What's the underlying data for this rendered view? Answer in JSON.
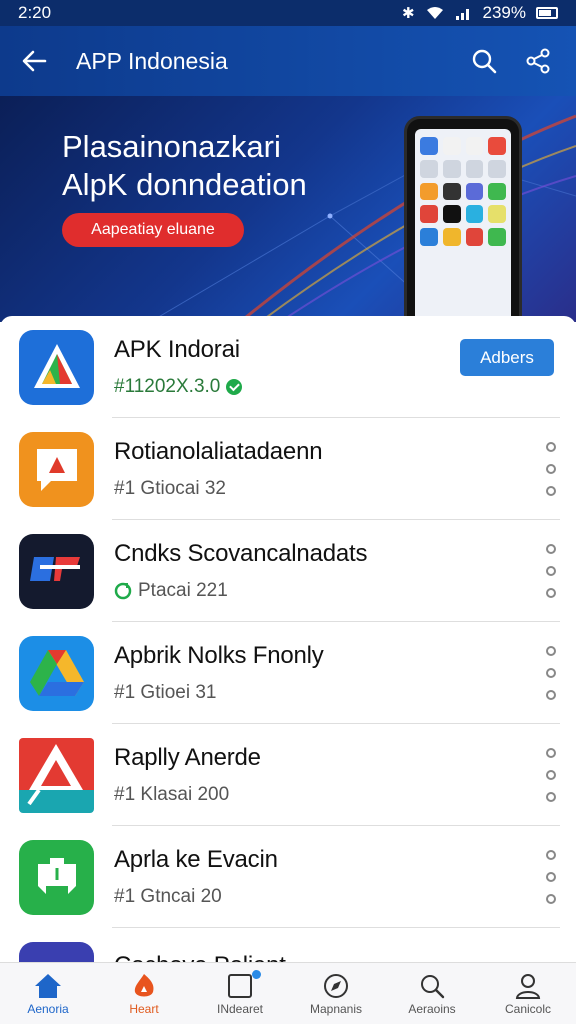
{
  "status_bar": {
    "time": "2:20",
    "battery": "239%"
  },
  "header": {
    "title": "APP Indonesia"
  },
  "banner": {
    "title_line1": "Plasainonazkari",
    "title_line2": "AlpK donndeation",
    "cta": "Aapeatiay eluane"
  },
  "apps": [
    {
      "name": "APK Indorai",
      "meta": "#11202X.3.0",
      "action": "Adbers"
    },
    {
      "name": "Rotianolaliatadaenn",
      "meta": "#1 Gtiocai 32"
    },
    {
      "name": "Cndks Scovancalnadats",
      "meta": "Ptacai 221"
    },
    {
      "name": "Apbrik Nolks Fnonly",
      "meta": "#1 Gtioei 31"
    },
    {
      "name": "Raplly Anerde",
      "meta": "#1 Klasai 200"
    },
    {
      "name": "Aprla ke Evacin",
      "meta": "#1 Gtncai 20"
    },
    {
      "name": "Cochove Poliant",
      "meta": ""
    }
  ],
  "nav": [
    {
      "label": "Aenoria"
    },
    {
      "label": "Heart"
    },
    {
      "label": "INdearet"
    },
    {
      "label": "Mapnanis"
    },
    {
      "label": "Aeraoins"
    },
    {
      "label": "Canicolc"
    }
  ],
  "colors": {
    "app_bar": "#1553b4",
    "primary_button": "#2b7fd9",
    "cta": "#e02d2d",
    "active_nav": "#1e66c9"
  }
}
